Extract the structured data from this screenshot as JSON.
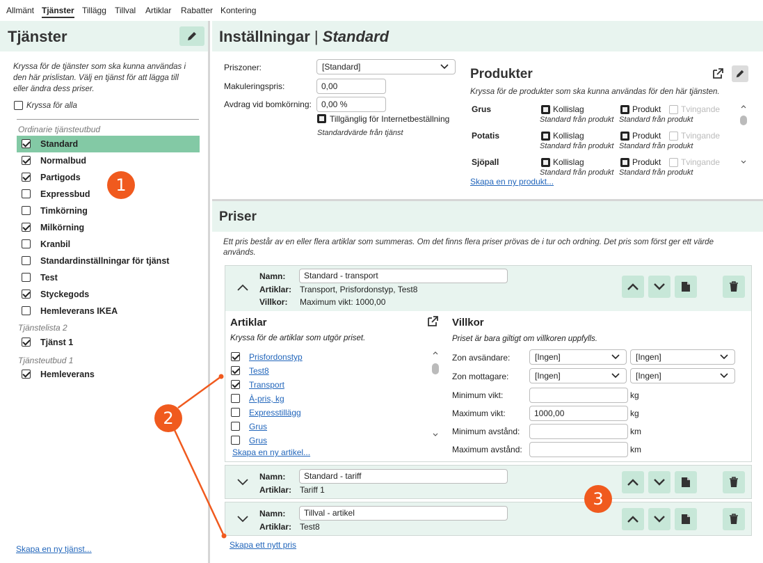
{
  "tabs": [
    "Allmänt",
    "Tjänster",
    "Tillägg",
    "Tillval",
    "Artiklar",
    "Rabatter",
    "Kontering"
  ],
  "left": {
    "title": "Tjänster",
    "description_lines": [
      "Kryssa för de tjänster som ska kunna användas i",
      "den här prislistan. Välj en tjänst för att lägga till",
      "eller ändra dess priser."
    ],
    "check_all": "Kryssa för alla",
    "group1": "Ordinarie tjänsteutbud",
    "services1": [
      {
        "label": "Standard",
        "checked": true
      },
      {
        "label": "Normalbud",
        "checked": true
      },
      {
        "label": "Partigods",
        "checked": true
      },
      {
        "label": "Expressbud",
        "checked": false
      },
      {
        "label": "Timkörning",
        "checked": false
      },
      {
        "label": "Milkörning",
        "checked": true
      },
      {
        "label": "Kranbil",
        "checked": false
      },
      {
        "label": "Standardinställningar för tjänst",
        "checked": false
      },
      {
        "label": "Test",
        "checked": false
      },
      {
        "label": "Styckegods",
        "checked": true
      },
      {
        "label": "Hemleverans IKEA",
        "checked": false
      }
    ],
    "group2": "Tjänstelista 2",
    "services2": [
      {
        "label": "Tjänst 1",
        "checked": true
      }
    ],
    "group3": "Tjänsteutbud 1",
    "services3": [
      {
        "label": "Hemleverans",
        "checked": true
      }
    ],
    "create_link": "Skapa en ny tjänst..."
  },
  "settings": {
    "title_prefix": "Inställningar",
    "separator": "|",
    "title_name": "Standard",
    "priszoner_label": "Priszoner:",
    "priszoner_value": "[Standard]",
    "makulering_label": "Makuleringspris:",
    "makulering_value": "0,00",
    "avdrag_label": "Avdrag vid bomkörning:",
    "avdrag_value": "0,00 %",
    "internet_label": "Tillgänglig för Internetbeställning",
    "default_note": "Standardvärde från tjänst"
  },
  "products": {
    "title": "Produkter",
    "description": "Kryssa för de produkter som ska kunna användas för den här tjänsten.",
    "kollislag": "Kollislag",
    "produkt": "Produkt",
    "tvingande": "Tvingande",
    "from_product": "Standard från produkt",
    "rows": [
      "Grus",
      "Potatis",
      "Sjöpall"
    ],
    "create_link": "Skapa en ny produkt..."
  },
  "prices": {
    "title": "Priser",
    "description_lines": [
      "Ett pris består av en eller flera artiklar som summeras. Om det finns flera priser prövas de i tur och ordning. Det pris som först ger ett värde",
      "används."
    ],
    "name_label": "Namn:",
    "articles_label": "Artiklar:",
    "conditions_label": "Villkor:",
    "items": [
      {
        "name": "Standard - transport",
        "articles": "Transport, Prisfordonstyp, Test8",
        "conditions": "Maximum vikt: 1000,00"
      },
      {
        "name": "Standard - tariff",
        "articles": "Tariff 1"
      },
      {
        "name": "Tillval - artikel",
        "articles": "Test8"
      }
    ],
    "articles_panel": {
      "title": "Artiklar",
      "description": "Kryssa för de artiklar som utgör priset.",
      "list": [
        {
          "label": "Prisfordonstyp",
          "checked": true
        },
        {
          "label": "Test8",
          "checked": true
        },
        {
          "label": "Transport",
          "checked": true
        },
        {
          "label": "À-pris, kg",
          "checked": false
        },
        {
          "label": "Expresstillägg",
          "checked": false
        },
        {
          "label": "Grus",
          "checked": false
        },
        {
          "label": "Grus",
          "checked": false
        }
      ],
      "create_link": "Skapa en ny artikel..."
    },
    "conditions_panel": {
      "title": "Villkor",
      "description": "Priset är bara giltigt om villkoren uppfylls.",
      "zone_sender": "Zon avsändare:",
      "zone_receiver": "Zon mottagare:",
      "none": "[Ingen]",
      "min_weight": "Minimum vikt:",
      "max_weight": "Maximum vikt:",
      "max_weight_value": "1000,00",
      "min_dist": "Minimum avstånd:",
      "max_dist": "Maximum avstånd:",
      "kg": "kg",
      "km": "km"
    },
    "create_link": "Skapa ett nytt pris"
  },
  "callouts": [
    "1",
    "2",
    "3"
  ],
  "colors": {
    "accent": "#83c9a5",
    "header_bg": "#e8f4ef",
    "button_bg": "#c7e7d8",
    "callout": "#f05a1e",
    "link": "#2266bb"
  }
}
